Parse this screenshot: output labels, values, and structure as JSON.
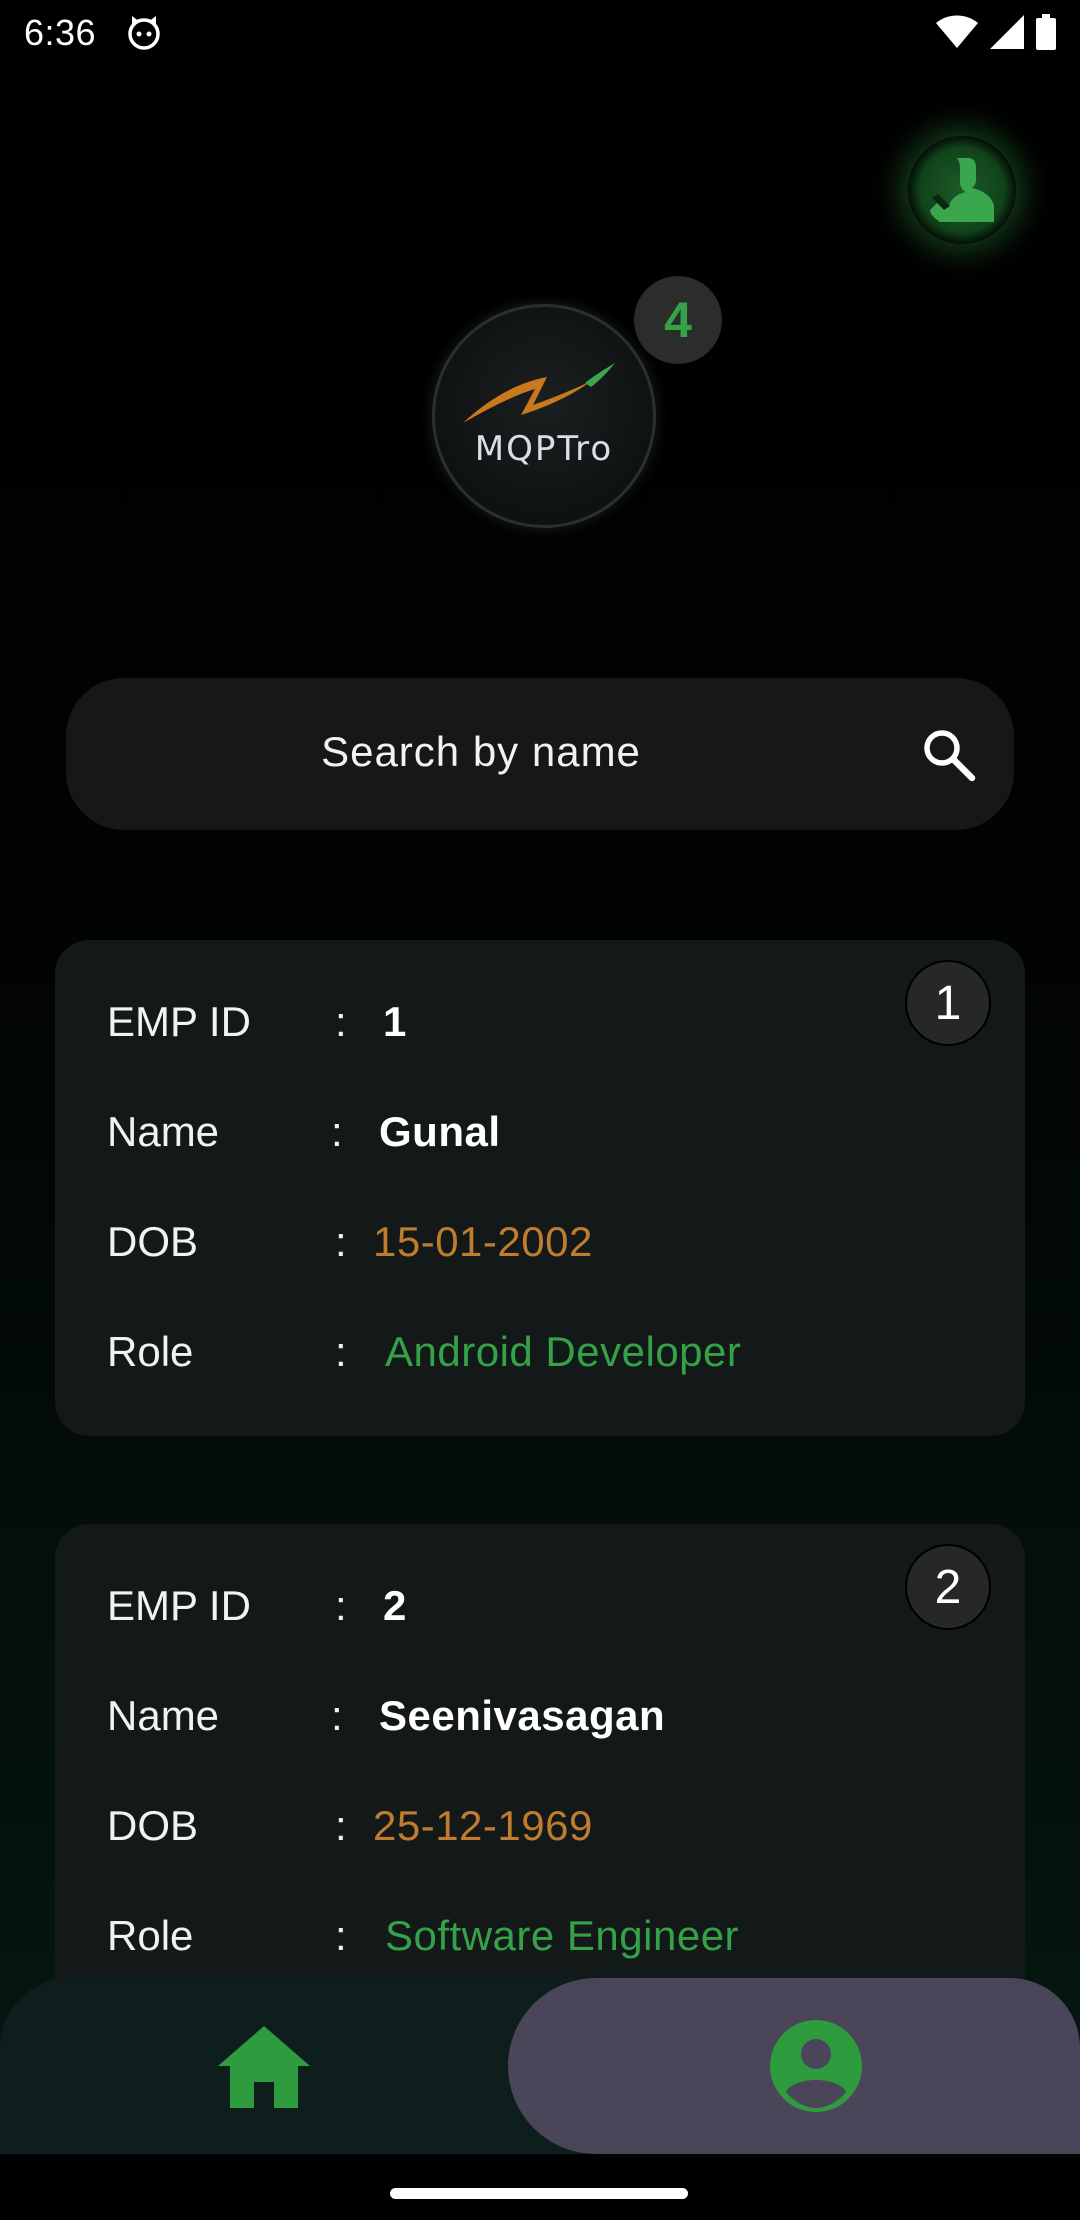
{
  "status_bar": {
    "time": "6:36",
    "icons": [
      "cat-notification-icon",
      "wifi-icon",
      "signal-icon",
      "battery-icon"
    ]
  },
  "header": {
    "logo_text": "MQPTro",
    "count_badge": "4",
    "profile_action_icon": "user-profile-icon"
  },
  "search": {
    "placeholder": "Search by name",
    "icon": "search-icon"
  },
  "labels": {
    "emp_id": "EMP ID",
    "name": "Name",
    "dob": "DOB",
    "role": "Role",
    "colon": ":"
  },
  "employees": [
    {
      "index": "1",
      "emp_id": "1",
      "name": "Gunal",
      "dob": "15-01-2002",
      "role": "Android Developer"
    },
    {
      "index": "2",
      "emp_id": "2",
      "name": "Seenivasagan",
      "dob": "25-12-1969",
      "role": "Software Engineer"
    }
  ],
  "bottom_nav": {
    "items": [
      {
        "name": "home",
        "icon": "home-icon",
        "selected": false
      },
      {
        "name": "profile",
        "icon": "account-circle-icon",
        "selected": true
      }
    ]
  },
  "colors": {
    "accent_green": "#36a248",
    "dob_orange": "#c07c2e",
    "card_bg": "#131818",
    "nav_selected_bg": "#4a4558"
  }
}
